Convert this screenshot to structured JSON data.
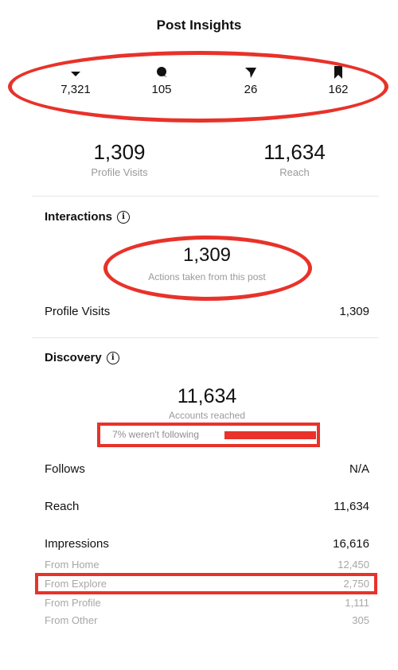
{
  "header": {
    "title": "Post Insights"
  },
  "top_metrics": [
    {
      "icon": "heart-down-icon",
      "value": "7,321"
    },
    {
      "icon": "comment-icon",
      "value": "105"
    },
    {
      "icon": "send-icon",
      "value": "26"
    },
    {
      "icon": "bookmark-icon",
      "value": "162"
    }
  ],
  "summary": {
    "profile_visits_value": "1,309",
    "profile_visits_label": "Profile Visits",
    "reach_value": "11,634",
    "reach_label": "Reach"
  },
  "interactions": {
    "heading": "Interactions",
    "value": "1,309",
    "label": "Actions taken from this post",
    "rows": [
      {
        "label": "Profile Visits",
        "value": "1,309"
      }
    ]
  },
  "discovery": {
    "heading": "Discovery",
    "value": "11,634",
    "label": "Accounts reached",
    "note": "7% weren't following",
    "rows": [
      {
        "label": "Follows",
        "value": "N/A"
      },
      {
        "label": "Reach",
        "value": "11,634"
      },
      {
        "label": "Impressions",
        "value": "16,616"
      }
    ],
    "breakdown": [
      {
        "label": "From Home",
        "value": "12,450"
      },
      {
        "label": "From Explore",
        "value": "2,750"
      },
      {
        "label": "From Profile",
        "value": "1,111"
      },
      {
        "label": "From Other",
        "value": "305"
      }
    ]
  },
  "colors": {
    "annotation": "#e8322a",
    "muted_text": "#9a9a9a"
  }
}
